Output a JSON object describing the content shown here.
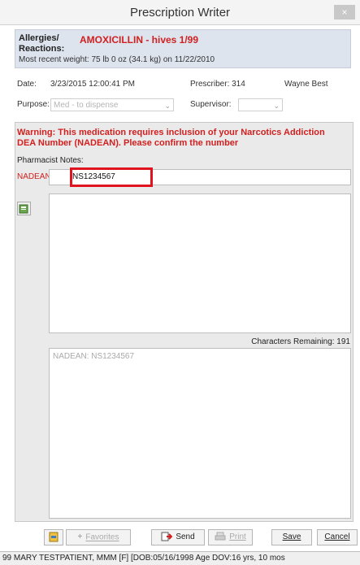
{
  "window": {
    "title": "Prescription Writer",
    "close_glyph": "×"
  },
  "allergy": {
    "label_line1": "Allergies/",
    "label_line2": "Reactions:",
    "value": "AMOXICILLIN  - hives  1/99",
    "weight": "Most recent weight:   75 lb 0 oz (34.1 kg) on 11/22/2010"
  },
  "meta": {
    "date_label": "Date:",
    "date_value": "3/23/2015 12:00:41 PM",
    "prescriber_label": "Prescriber: 314",
    "prescriber_name": "Wayne Best",
    "purpose_label": "Purpose:",
    "purpose_value": "Med - to dispense",
    "supervisor_label": "Supervisor:",
    "supervisor_value": ""
  },
  "warning": "Warning: This medication requires inclusion of your Narcotics Addiction DEA Number (NADEAN). Please confirm the number",
  "pharmacist_notes_label": "Pharmacist Notes:",
  "nadean": {
    "label": "NADEAN:",
    "value": "NS1234567"
  },
  "chars_remaining": "Characters Remaining: 191",
  "preview_text": "NADEAN: NS1234567",
  "buttons": {
    "favorites": "Favorites",
    "send": "Send",
    "print": "Print",
    "save": "Save",
    "cancel": "Cancel"
  },
  "status": "99 MARY TESTPATIENT, MMM [F] [DOB:05/16/1998  Age DOV:16 yrs, 10 mos"
}
